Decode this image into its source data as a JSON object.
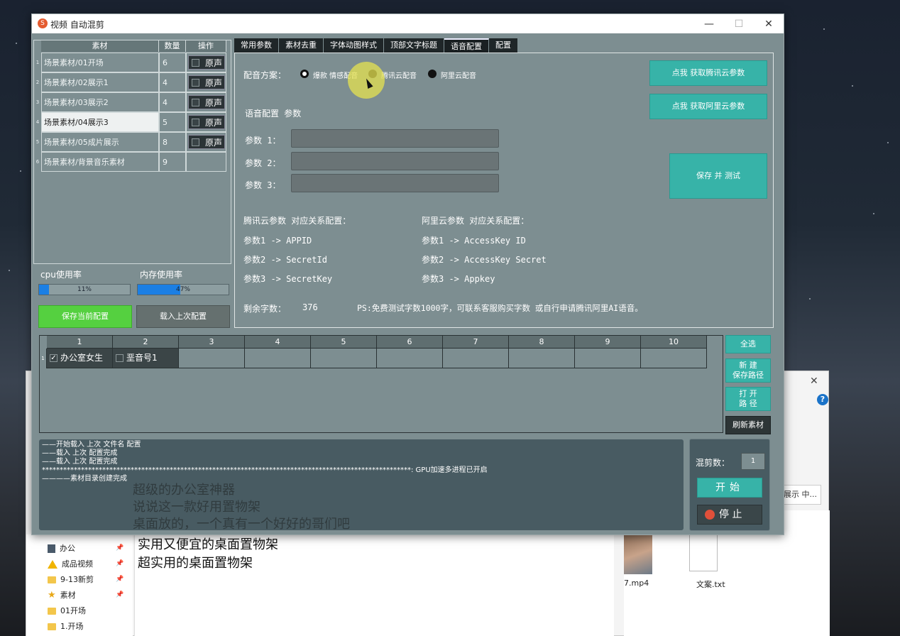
{
  "app": {
    "title": "视频 自动混剪",
    "minimize": "—",
    "maximize": "☐",
    "close": "✕"
  },
  "materials": {
    "headers": [
      "素材",
      "数量",
      "操作"
    ],
    "rows": [
      {
        "idx": "1",
        "name": "场景素材/01开场",
        "count": "6",
        "op": "原声"
      },
      {
        "idx": "2",
        "name": "场景素材/02展示1",
        "count": "4",
        "op": "原声"
      },
      {
        "idx": "3",
        "name": "场景素材/03展示2",
        "count": "4",
        "op": "原声"
      },
      {
        "idx": "4",
        "name": "场景素材/04展示3",
        "count": "5",
        "op": "原声"
      },
      {
        "idx": "5",
        "name": "场景素材/05成片展示",
        "count": "8",
        "op": "原声"
      },
      {
        "idx": "6",
        "name": "场景素材/背景音乐素材",
        "count": "9",
        "op": ""
      }
    ]
  },
  "usage": {
    "cpu_label": "cpu使用率",
    "mem_label": "内存使用率",
    "cpu_text": "11%",
    "cpu_value": 0.11,
    "mem_text": "47%",
    "mem_value": 0.47
  },
  "left_buttons": {
    "save": "保存当前配置",
    "load": "载入上次配置"
  },
  "tabs": [
    "常用参数",
    "素材去重",
    "字体动图样式",
    "顶部文字标题",
    "语音配置",
    "配置"
  ],
  "active_tab": 4,
  "voice": {
    "scheme_label": "配音方案：",
    "options": [
      {
        "label": "爆款 情感配音",
        "checked": true
      },
      {
        "label": "腾讯云配音",
        "checked": false
      },
      {
        "label": "阿里云配音",
        "checked": false
      }
    ],
    "section_title": "语音配置 参数",
    "params": [
      {
        "label": "参数 1：",
        "value": ""
      },
      {
        "label": "参数 2：",
        "value": ""
      },
      {
        "label": "参数 3：",
        "value": ""
      }
    ],
    "tencent_btn": "点我 获取腾讯云参数",
    "ali_btn": "点我 获取阿里云参数",
    "save_test_btn": "保存 并 测试",
    "tencent_title": "腾讯云参数 对应关系配置：",
    "tencent_map": [
      "参数1 -> APPID",
      "参数2 -> SecretId",
      "参数3 -> SecretKey"
    ],
    "ali_title": "阿里云参数 对应关系配置：",
    "ali_map": [
      "参数1 -> AccessKey ID",
      "参数2 -> AccessKey Secret",
      "参数3 -> Appkey"
    ],
    "remaining_label": "剩余字数：",
    "remaining_value": "376",
    "ps_note": "PS:免费测试字数1000字，可联系客服购买字数 或自行申请腾讯阿里AI语音。"
  },
  "grid": {
    "columns": [
      "1",
      "2",
      "3",
      "4",
      "5",
      "6",
      "7",
      "8",
      "9",
      "10"
    ],
    "row_idx": "1",
    "cells": [
      {
        "text": "办公室女生",
        "checked": true
      },
      {
        "text": "垩音号1",
        "checked": false
      }
    ]
  },
  "side_buttons": {
    "select_all": "全选",
    "new_save_path": "新 建\n保存路径",
    "open_path": "打 开\n路 径",
    "refresh": "刷新素材"
  },
  "log": {
    "lines": [
      "——开始载入 上次 文件名  配置",
      "——载入 上次 配置完成",
      "——载入 上次 配置完成",
      "********************************************************************************************************: GPU加速多进程已开启",
      "————素材目录创建完成"
    ]
  },
  "mix": {
    "count_label": "混剪数：",
    "count_value": "1",
    "start": "开始",
    "stop": "停 止"
  },
  "explorer": {
    "nav": [
      {
        "label": "办公",
        "icon": "drive-icon"
      },
      {
        "label": "成品视频",
        "icon": "warning-icon"
      },
      {
        "label": "9-13新剪",
        "icon": "folder-icon"
      },
      {
        "label": "素材",
        "icon": "star-icon"
      },
      {
        "label": "01开场",
        "icon": "folder-icon"
      },
      {
        "label": "1.开场",
        "icon": "folder-icon"
      }
    ],
    "doc_lines": [
      "实用又便宜的桌面置物架",
      "超实用的桌面置物架"
    ],
    "ghost_lines": [
      "超级的办公室神器",
      "说说这一款好用置物架",
      "桌面放的，一个真有一个好好的哥们吧"
    ],
    "files": [
      "7.mp4",
      "文案.txt"
    ],
    "crumb_fragment": "展示 中..."
  }
}
